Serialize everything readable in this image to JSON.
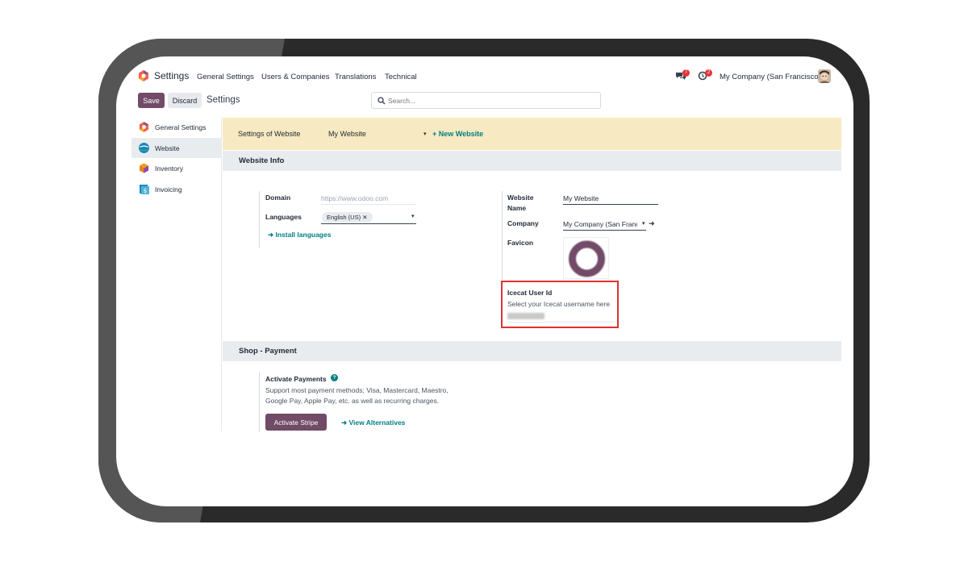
{
  "app": {
    "title": "Settings",
    "nav": [
      "General Settings",
      "Users & Companies",
      "Translations",
      "Technical"
    ],
    "systray": {
      "messages_count": "7",
      "activities_count": "2"
    },
    "company": "My Company (San Francisco)"
  },
  "control": {
    "save_label": "Save",
    "discard_label": "Discard",
    "page_title": "Settings",
    "search_placeholder": "Search..."
  },
  "sidebar": {
    "items": [
      {
        "label": "General Settings",
        "icon": "odoo-logo-icon"
      },
      {
        "label": "Website",
        "icon": "website-icon",
        "active": true
      },
      {
        "label": "Inventory",
        "icon": "inventory-icon"
      },
      {
        "label": "Invoicing",
        "icon": "invoicing-icon"
      }
    ]
  },
  "website_bar": {
    "label": "Settings of Website",
    "selected": "My Website",
    "new_label": "+ New Website"
  },
  "website_info": {
    "heading": "Website Info",
    "domain_label": "Domain",
    "domain_placeholder": "https://www.odoo.com",
    "languages_label": "Languages",
    "language_tag": "English (US)",
    "install_link": "Install languages",
    "website_name_label_1": "Website",
    "website_name_label_2": "Name",
    "website_name_value": "My Website",
    "company_label": "Company",
    "company_value": "My Company (San Franc",
    "favicon_label": "Favicon",
    "icecat_label": "Icecat User Id",
    "icecat_help": "Select your Icecat username here"
  },
  "shop_payment": {
    "heading": "Shop - Payment",
    "title": "Activate Payments",
    "description": "Support most payment methods; Visa, Mastercard, Maestro, Google Pay, Apple Pay, etc. as well as recurring charges.",
    "activate_label": "Activate Stripe",
    "alternatives_label": "View Alternatives"
  },
  "colors": {
    "primary": "#714b67",
    "link": "#017e84",
    "highlight": "#e03131",
    "banner": "#f7e9c1"
  }
}
